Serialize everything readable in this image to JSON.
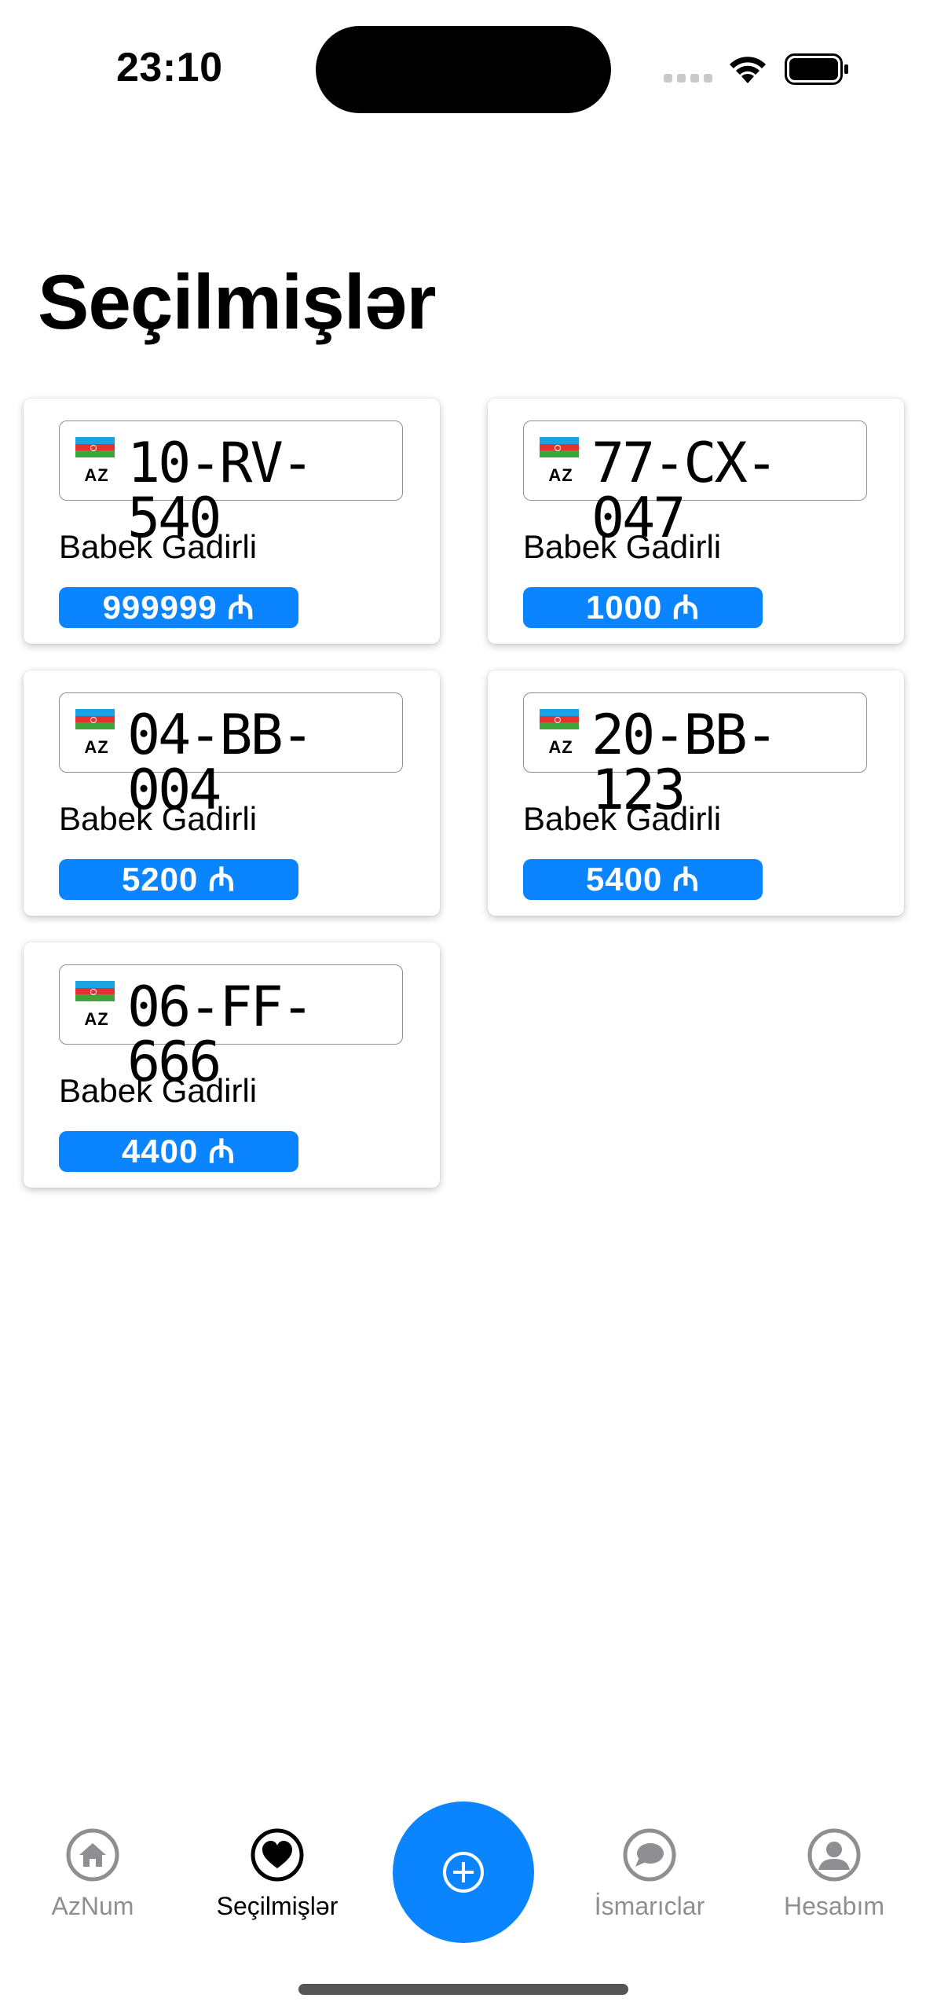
{
  "status_bar": {
    "time": "23:10"
  },
  "page": {
    "title": "Seçilmişlər"
  },
  "listings": [
    {
      "country_code": "AZ",
      "plate": "10-RV-540",
      "seller": "Babek Gadirli",
      "price": "999999 ₼"
    },
    {
      "country_code": "AZ",
      "plate": "77-CX-047",
      "seller": "Babek Gadirli",
      "price": "1000 ₼"
    },
    {
      "country_code": "AZ",
      "plate": "04-BB-004",
      "seller": "Babek Gadirli",
      "price": "5200 ₼"
    },
    {
      "country_code": "AZ",
      "plate": "20-BB-123",
      "seller": "Babek Gadirli",
      "price": "5400 ₼"
    },
    {
      "country_code": "AZ",
      "plate": "06-FF-666",
      "seller": "Babek Gadirli",
      "price": "4400 ₼"
    }
  ],
  "tabbar": {
    "tabs": [
      {
        "label": "AzNum",
        "icon": "home-icon",
        "active": false
      },
      {
        "label": "Seçilmişlər",
        "icon": "heart-icon",
        "active": true
      },
      {
        "label": "İsmarıclar",
        "icon": "chat-bubble-icon",
        "active": false
      },
      {
        "label": "Hesabım",
        "icon": "person-icon",
        "active": false
      }
    ],
    "add_button_icon": "plus-circle-icon"
  },
  "colors": {
    "accent": "#0a84ff",
    "inactive": "#8e8e93"
  }
}
